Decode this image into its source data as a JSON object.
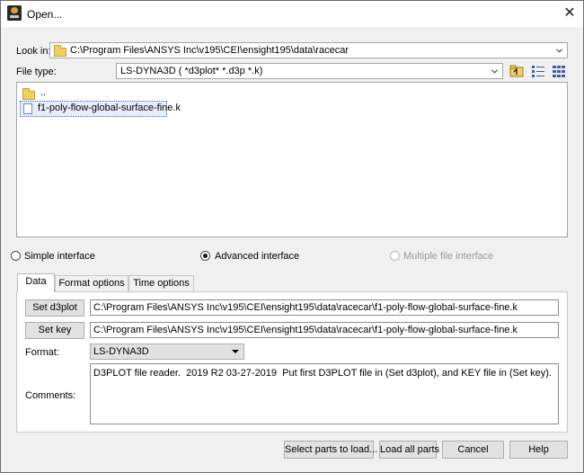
{
  "window": {
    "title": "Open...",
    "close_glyph": "✕"
  },
  "look_in": {
    "label": "Look in:",
    "value": "C:\\Program Files\\ANSYS Inc\\v195\\CEI\\ensight195\\data\\racecar"
  },
  "file_type": {
    "label": "File type:",
    "value": "LS-DYNA3D ( *d3plot* *.d3p *.k)"
  },
  "toolbar": {
    "icons": [
      "up-folder-icon",
      "list-view-icon",
      "detail-view-icon"
    ]
  },
  "files": [
    {
      "name": "..",
      "kind": "folder"
    },
    {
      "name": "f1-poly-flow-global-surface-fine.k",
      "kind": "file",
      "selected": true
    }
  ],
  "interface": {
    "simple": "Simple interface",
    "advanced": "Advanced interface",
    "multiple": "Multiple file interface",
    "selected": "advanced"
  },
  "tabs": [
    "Data",
    "Format options",
    "Time options"
  ],
  "data_tab": {
    "set_d3plot_label": "Set d3plot",
    "d3plot_path": "C:\\Program Files\\ANSYS Inc\\v195\\CEI\\ensight195\\data\\racecar\\f1-poly-flow-global-surface-fine.k",
    "set_key_label": "Set key",
    "key_path": "C:\\Program Files\\ANSYS Inc\\v195\\CEI\\ensight195\\data\\racecar\\f1-poly-flow-global-surface-fine.k",
    "format_label": "Format:",
    "format_value": "LS-DYNA3D",
    "comments_label": "Comments:",
    "comments_value": "D3PLOT file reader.  2019 R2 03-27-2019  Put first D3PLOT file in (Set d3plot), and KEY file in (Set key)."
  },
  "buttons": {
    "select_parts": "Select parts to load...",
    "load_all": "Load all parts",
    "cancel": "Cancel",
    "help": "Help"
  },
  "colors": {
    "accent": "#3b6ac6",
    "folder": "#f2cf63"
  }
}
